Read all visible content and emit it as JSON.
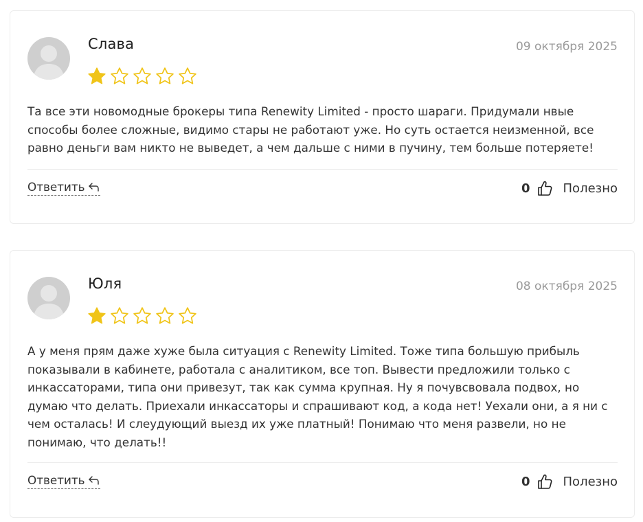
{
  "reviews": [
    {
      "author": "Слава",
      "date": "09 октября 2025",
      "rating": 1,
      "max_rating": 5,
      "text": "Та все эти новомодные брокеры типа Renewity Limited - просто шараги. Придумали нвые способы более сложные, видимо стары не работают уже. Но суть остается неизменной, все равно деньги вам никто не выведет, а чем дальше с ними в пучину, тем больше потеряете!",
      "reply_label": "Ответить",
      "votes": "0",
      "useful_label": "Полезно"
    },
    {
      "author": "Юля",
      "date": "08 октября 2025",
      "rating": 1,
      "max_rating": 5,
      "text": "А у меня прям даже хуже была ситуация с Renewity Limited. Тоже типа большую прибыль показывали в кабинете, работала с аналитиком, все топ. Вывести предложили только с инкассаторами, типа они привезут, так как сумма крупная. Ну я почувсвовала подвох, но думаю что делать. Приехали инкассаторы и спрашивают код, а кода нет! Уехали они, а я ни с чем осталась! И слеудующий выезд их уже платный! Понимаю что меня развели, но не понимаю, что делать!!",
      "reply_label": "Ответить",
      "votes": "0",
      "useful_label": "Полезно"
    }
  ],
  "colors": {
    "star_filled": "#f0c419",
    "star_empty_stroke": "#f0c419",
    "avatar_bg": "#cfcfcf",
    "date": "#9a9a9a"
  },
  "icons": {
    "avatar": "user-silhouette-icon",
    "star": "star-icon",
    "reply": "reply-arrow-icon",
    "like": "thumbs-up-icon"
  }
}
